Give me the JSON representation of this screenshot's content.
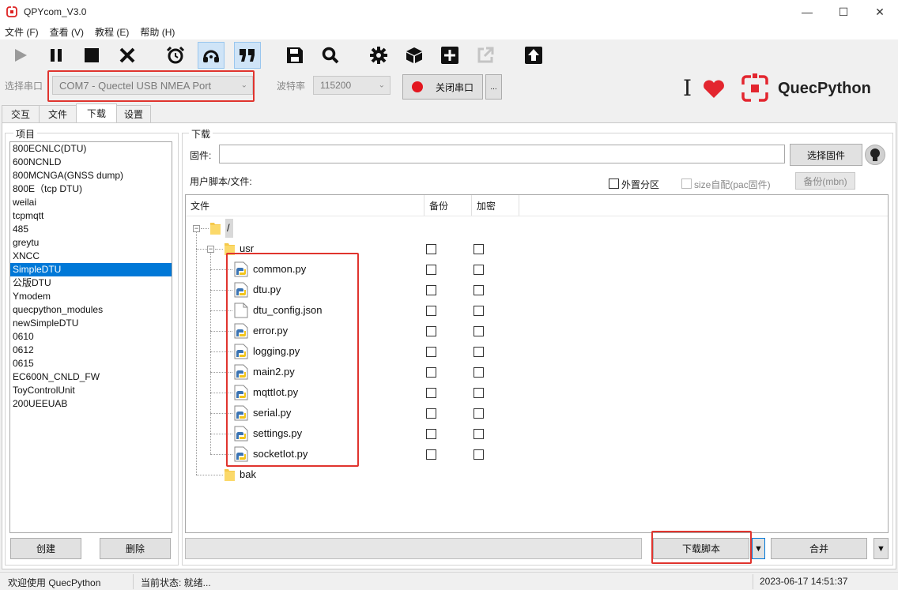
{
  "window": {
    "title": "QPYcom_V3.0",
    "minimize": "—",
    "maximize": "☐",
    "close": "✕"
  },
  "menu": [
    "文件 (F)",
    "查看 (V)",
    "教程 (E)",
    "帮助 (H)"
  ],
  "toolbar": {
    "icons": [
      "play-icon",
      "pause-icon",
      "stop-icon",
      "close-icon",
      "alarm-clock-icon",
      "headset-icon",
      "quote-icon",
      "save-icon",
      "search-icon",
      "gear-icon",
      "cube-icon",
      "plus-icon",
      "external-link-icon",
      "upload-icon"
    ]
  },
  "port": {
    "select_label": "选择串口",
    "port_value": "COM7 - Quectel USB NMEA Port",
    "baud_label": "波特率",
    "baud_value": "115200",
    "toggle_label": "关闭串口",
    "more_label": "..."
  },
  "brand": {
    "text": "QuecPython",
    "i_letter": "I"
  },
  "tabs": [
    "交互",
    "文件",
    "下载",
    "设置"
  ],
  "selected_tab": "下载",
  "project": {
    "group_label": "项目",
    "items": [
      "800ECNLC(DTU)",
      "600NCNLD",
      "800MCNGA(GNSS dump)",
      "800E（tcp DTU)",
      "weilai",
      "tcpmqtt",
      "485",
      "greytu",
      "XNCC",
      "SimpleDTU",
      "公版DTU",
      "Ymodem",
      "quecpython_modules",
      "newSimpleDTU",
      "0610",
      "0612",
      "0615",
      "EC600N_CNLD_FW",
      "ToyControlUnit",
      "200UEEUAB"
    ],
    "selected": "SimpleDTU",
    "create_label": "创建",
    "delete_label": "删除"
  },
  "download": {
    "group_label": "下载",
    "firmware_label": "固件:",
    "firmware_value": "",
    "select_fw_label": "选择固件",
    "user_files_label": "用户脚本/文件:",
    "ext_partition_label": "外置分区",
    "size_auto_label": "size自配(pac固件)",
    "backup_mbn_label": "备份(mbn)",
    "columns": {
      "file": "文件",
      "backup": "备份",
      "encrypt": "加密"
    },
    "root": "/",
    "usr_folder": "usr",
    "files": [
      "common.py",
      "dtu.py",
      "dtu_config.json",
      "error.py",
      "logging.py",
      "main2.py",
      "mqttIot.py",
      "serial.py",
      "settings.py",
      "socketIot.py"
    ],
    "bak_folder": "bak",
    "download_script_label": "下载脚本",
    "merge_label": "合并",
    "dropdown_glyph": "▼"
  },
  "status": {
    "welcome": "欢迎使用 QuecPython",
    "state": "当前状态: 就绪...",
    "datetime": "2023-06-17 14:51:37"
  },
  "colors": {
    "accent": "#0078d7",
    "highlight": "#e0342e",
    "brand_red": "#e3262f"
  }
}
